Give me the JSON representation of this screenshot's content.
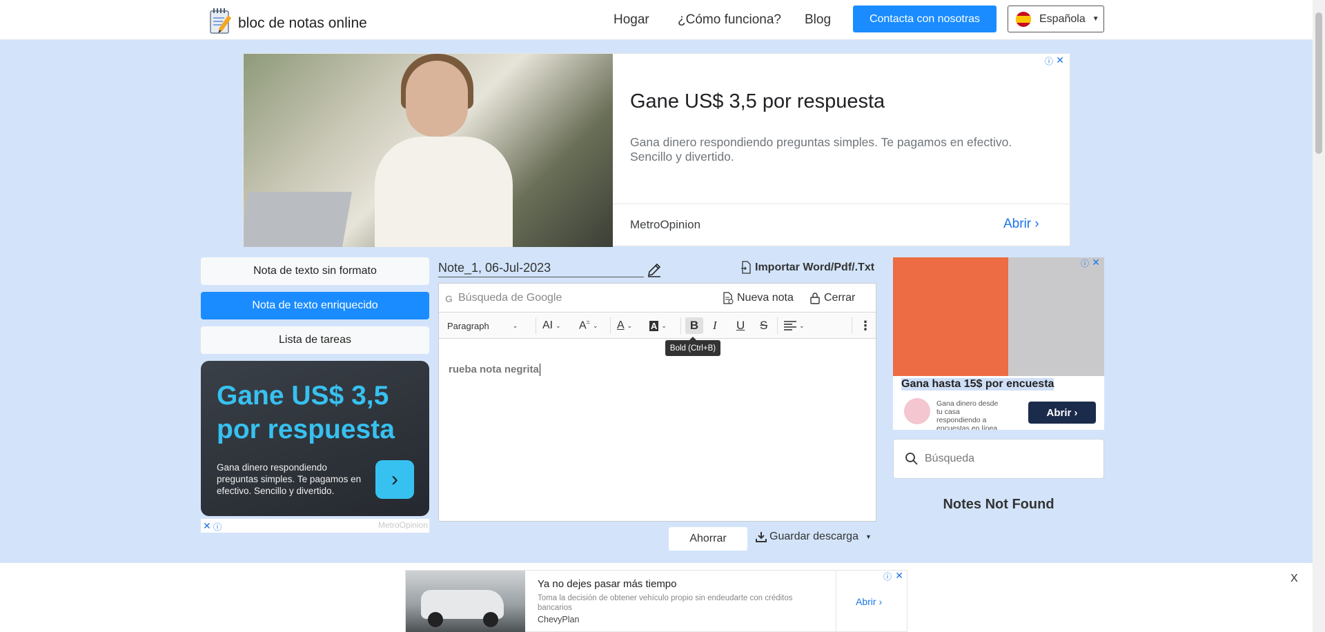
{
  "header": {
    "logo_text": "bloc de notas online",
    "nav": [
      {
        "label": "Hogar"
      },
      {
        "label": "¿Cómo funciona?"
      },
      {
        "label": "Blog"
      }
    ],
    "contact_button": "Contacta con nosotras",
    "language": "Española"
  },
  "ads": {
    "top": {
      "headline": "Gane US$ 3,5 por respuesta",
      "description": "Gana dinero respondiendo preguntas simples. Te pagamos en efectivo. Sencillo y divertido.",
      "brand": "MetroOpinion",
      "cta": "Abrir"
    },
    "left": {
      "headline": "Gane US$ 3,5 por respuesta",
      "description": "Gana dinero respondiendo preguntas simples. Te pagamos en efectivo. Sencillo y divertido.",
      "brand": "MetroOpinion"
    },
    "right": {
      "headline": "Gana hasta 15$ por encuesta",
      "description": "Gana dinero desde tu casa respondiendo a encuestas en línea",
      "cta": "Abrir"
    },
    "bottom": {
      "headline": "Ya no dejes pasar más tiempo",
      "description": "Toma la decisión de obtener vehículo propio sin endeudarte con créditos bancarios",
      "brand": "ChevyPlan",
      "cta": "Abrir",
      "close": "X"
    }
  },
  "modes": [
    {
      "label": "Nota de texto sin formato",
      "active": false
    },
    {
      "label": "Nota de texto enriquecido",
      "active": true
    },
    {
      "label": "Lista de tareas",
      "active": false
    }
  ],
  "editor": {
    "note_title": "Note_1, 06-Jul-2023",
    "import_label": "Importar Word/Pdf/.Txt",
    "search_placeholder": "Búsqueda de Google",
    "new_note": "Nueva nota",
    "close": "Cerrar",
    "toolbar": {
      "paragraph": "Paragraph",
      "bold": "B",
      "italic": "I",
      "underline": "U",
      "strike": "S",
      "bold_tooltip": "Bold (Ctrl+B)"
    },
    "content": "rueba nota negrita",
    "save": "Ahorrar",
    "save_download": "Guardar descarga"
  },
  "sidebar": {
    "search_placeholder": "Búsqueda",
    "notes_status": "Notes Not Found"
  }
}
